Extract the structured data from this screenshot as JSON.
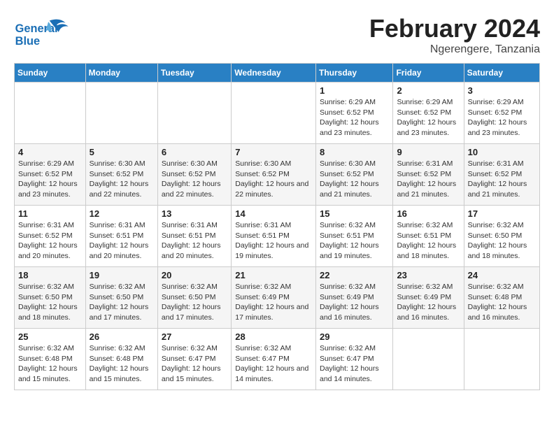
{
  "header": {
    "logo_general": "General",
    "logo_blue": "Blue",
    "title_month": "February 2024",
    "title_location": "Ngerengere, Tanzania"
  },
  "days_of_week": [
    "Sunday",
    "Monday",
    "Tuesday",
    "Wednesday",
    "Thursday",
    "Friday",
    "Saturday"
  ],
  "weeks": [
    [
      {
        "day": "",
        "detail": ""
      },
      {
        "day": "",
        "detail": ""
      },
      {
        "day": "",
        "detail": ""
      },
      {
        "day": "",
        "detail": ""
      },
      {
        "day": "1",
        "detail": "Sunrise: 6:29 AM\nSunset: 6:52 PM\nDaylight: 12 hours\nand 23 minutes."
      },
      {
        "day": "2",
        "detail": "Sunrise: 6:29 AM\nSunset: 6:52 PM\nDaylight: 12 hours\nand 23 minutes."
      },
      {
        "day": "3",
        "detail": "Sunrise: 6:29 AM\nSunset: 6:52 PM\nDaylight: 12 hours\nand 23 minutes."
      }
    ],
    [
      {
        "day": "4",
        "detail": "Sunrise: 6:29 AM\nSunset: 6:52 PM\nDaylight: 12 hours\nand 23 minutes."
      },
      {
        "day": "5",
        "detail": "Sunrise: 6:30 AM\nSunset: 6:52 PM\nDaylight: 12 hours\nand 22 minutes."
      },
      {
        "day": "6",
        "detail": "Sunrise: 6:30 AM\nSunset: 6:52 PM\nDaylight: 12 hours\nand 22 minutes."
      },
      {
        "day": "7",
        "detail": "Sunrise: 6:30 AM\nSunset: 6:52 PM\nDaylight: 12 hours\nand 22 minutes."
      },
      {
        "day": "8",
        "detail": "Sunrise: 6:30 AM\nSunset: 6:52 PM\nDaylight: 12 hours\nand 21 minutes."
      },
      {
        "day": "9",
        "detail": "Sunrise: 6:31 AM\nSunset: 6:52 PM\nDaylight: 12 hours\nand 21 minutes."
      },
      {
        "day": "10",
        "detail": "Sunrise: 6:31 AM\nSunset: 6:52 PM\nDaylight: 12 hours\nand 21 minutes."
      }
    ],
    [
      {
        "day": "11",
        "detail": "Sunrise: 6:31 AM\nSunset: 6:52 PM\nDaylight: 12 hours\nand 20 minutes."
      },
      {
        "day": "12",
        "detail": "Sunrise: 6:31 AM\nSunset: 6:51 PM\nDaylight: 12 hours\nand 20 minutes."
      },
      {
        "day": "13",
        "detail": "Sunrise: 6:31 AM\nSunset: 6:51 PM\nDaylight: 12 hours\nand 20 minutes."
      },
      {
        "day": "14",
        "detail": "Sunrise: 6:31 AM\nSunset: 6:51 PM\nDaylight: 12 hours\nand 19 minutes."
      },
      {
        "day": "15",
        "detail": "Sunrise: 6:32 AM\nSunset: 6:51 PM\nDaylight: 12 hours\nand 19 minutes."
      },
      {
        "day": "16",
        "detail": "Sunrise: 6:32 AM\nSunset: 6:51 PM\nDaylight: 12 hours\nand 18 minutes."
      },
      {
        "day": "17",
        "detail": "Sunrise: 6:32 AM\nSunset: 6:50 PM\nDaylight: 12 hours\nand 18 minutes."
      }
    ],
    [
      {
        "day": "18",
        "detail": "Sunrise: 6:32 AM\nSunset: 6:50 PM\nDaylight: 12 hours\nand 18 minutes."
      },
      {
        "day": "19",
        "detail": "Sunrise: 6:32 AM\nSunset: 6:50 PM\nDaylight: 12 hours\nand 17 minutes."
      },
      {
        "day": "20",
        "detail": "Sunrise: 6:32 AM\nSunset: 6:50 PM\nDaylight: 12 hours\nand 17 minutes."
      },
      {
        "day": "21",
        "detail": "Sunrise: 6:32 AM\nSunset: 6:49 PM\nDaylight: 12 hours\nand 17 minutes."
      },
      {
        "day": "22",
        "detail": "Sunrise: 6:32 AM\nSunset: 6:49 PM\nDaylight: 12 hours\nand 16 minutes."
      },
      {
        "day": "23",
        "detail": "Sunrise: 6:32 AM\nSunset: 6:49 PM\nDaylight: 12 hours\nand 16 minutes."
      },
      {
        "day": "24",
        "detail": "Sunrise: 6:32 AM\nSunset: 6:48 PM\nDaylight: 12 hours\nand 16 minutes."
      }
    ],
    [
      {
        "day": "25",
        "detail": "Sunrise: 6:32 AM\nSunset: 6:48 PM\nDaylight: 12 hours\nand 15 minutes."
      },
      {
        "day": "26",
        "detail": "Sunrise: 6:32 AM\nSunset: 6:48 PM\nDaylight: 12 hours\nand 15 minutes."
      },
      {
        "day": "27",
        "detail": "Sunrise: 6:32 AM\nSunset: 6:47 PM\nDaylight: 12 hours\nand 15 minutes."
      },
      {
        "day": "28",
        "detail": "Sunrise: 6:32 AM\nSunset: 6:47 PM\nDaylight: 12 hours\nand 14 minutes."
      },
      {
        "day": "29",
        "detail": "Sunrise: 6:32 AM\nSunset: 6:47 PM\nDaylight: 12 hours\nand 14 minutes."
      },
      {
        "day": "",
        "detail": ""
      },
      {
        "day": "",
        "detail": ""
      }
    ]
  ]
}
